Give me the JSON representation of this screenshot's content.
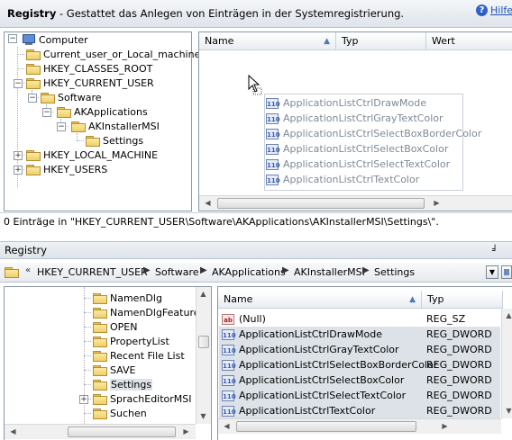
{
  "header": {
    "title": "Registry",
    "subtitle": " - Gestattet das Anlegen von Einträgen in der Systemregistrierung.",
    "help_label": "Hilfe"
  },
  "top_tree": {
    "items": [
      {
        "label": "Computer",
        "icon": "computer-icon"
      },
      {
        "label": "Current_user_or_Local_machine",
        "icon": "folder-icon"
      },
      {
        "label": "HKEY_CLASSES_ROOT",
        "icon": "folder-icon"
      },
      {
        "label": "HKEY_CURRENT_USER",
        "icon": "folder-icon"
      },
      {
        "label": "Software",
        "icon": "folder-icon"
      },
      {
        "label": "AKApplications",
        "icon": "folder-icon"
      },
      {
        "label": "AKInstallerMSI",
        "icon": "folder-icon"
      },
      {
        "label": "Settings",
        "icon": "folder-icon"
      },
      {
        "label": "HKEY_LOCAL_MACHINE",
        "icon": "folder-icon"
      },
      {
        "label": "HKEY_USERS",
        "icon": "folder-icon"
      }
    ]
  },
  "top_list": {
    "columns": [
      "Name",
      "Typ",
      "Wert"
    ],
    "drag_items": [
      "ApplicationListCtrlDrawMode",
      "ApplicationListCtrlGrayTextColor",
      "ApplicationListCtrlSelectBoxBorderColor",
      "ApplicationListCtrlSelectBoxColor",
      "ApplicationListCtrlSelectTextColor",
      "ApplicationListCtrlTextColor"
    ]
  },
  "status": {
    "text": "0 Einträge in \"HKEY_CURRENT_USER\\Software\\AKApplications\\AKInstallerMSI\\Settings\\\"."
  },
  "bottom_window": {
    "title": "Registry",
    "pin_label": "╛",
    "close_label": "×"
  },
  "breadcrumb": {
    "lead": "«",
    "items": [
      "HKEY_CURRENT_USER",
      "Software",
      "AKApplications",
      "AKInstallerMSI",
      "Settings"
    ]
  },
  "bottom_tree": {
    "items": [
      "NamenDlg",
      "NamenDlgFeature",
      "OPEN",
      "PropertyList",
      "Recent File List",
      "SAVE",
      "Settings",
      "SprachEditorMSI",
      "Suchen"
    ]
  },
  "bottom_list": {
    "columns": [
      "Name",
      "Typ"
    ],
    "rows": [
      {
        "name": "(Null)",
        "type": "REG_SZ",
        "icon": "string-value-icon"
      },
      {
        "name": "ApplicationListCtrlDrawMode",
        "type": "REG_DWORD",
        "icon": "dword-value-icon"
      },
      {
        "name": "ApplicationListCtrlGrayTextColor",
        "type": "REG_DWORD",
        "icon": "dword-value-icon"
      },
      {
        "name": "ApplicationListCtrlSelectBoxBorderColor",
        "type": "REG_DWORD",
        "icon": "dword-value-icon"
      },
      {
        "name": "ApplicationListCtrlSelectBoxColor",
        "type": "REG_DWORD",
        "icon": "dword-value-icon"
      },
      {
        "name": "ApplicationListCtrlSelectTextColor",
        "type": "REG_DWORD",
        "icon": "dword-value-icon"
      },
      {
        "name": "ApplicationListCtrlTextColor",
        "type": "REG_DWORD",
        "icon": "dword-value-icon"
      }
    ]
  },
  "icons": {
    "sz_glyph": "ab",
    "dword_glyph": "110"
  }
}
